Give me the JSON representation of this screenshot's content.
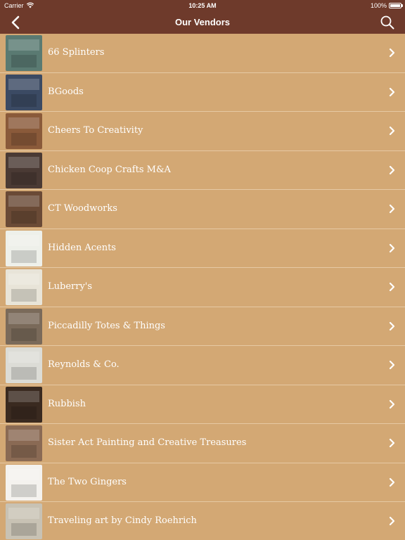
{
  "status_bar": {
    "carrier": "Carrier",
    "time": "10:25 AM",
    "battery": "100%"
  },
  "nav": {
    "title": "Our Vendors",
    "back_icon": "chevron-left-icon",
    "search_icon": "search-icon"
  },
  "vendors": [
    {
      "name": "66 Splinters",
      "thumb_color": "#5a7a72"
    },
    {
      "name": "BGoods",
      "thumb_color": "#3b4a63"
    },
    {
      "name": "Cheers To Creativity",
      "thumb_color": "#8a5a3a"
    },
    {
      "name": "Chicken Coop Crafts M&A",
      "thumb_color": "#4a3a34"
    },
    {
      "name": "CT Woodworks",
      "thumb_color": "#6a4a36"
    },
    {
      "name": "Hidden Acents",
      "thumb_color": "#eef0ea"
    },
    {
      "name": "Luberry's",
      "thumb_color": "#e8e4d8"
    },
    {
      "name": "Piccadilly Totes & Things",
      "thumb_color": "#7a6a5a"
    },
    {
      "name": "Reynolds & Co.",
      "thumb_color": "#dcdcd6"
    },
    {
      "name": "Rubbish",
      "thumb_color": "#3a2a20"
    },
    {
      "name": "Sister Act Painting and Creative Treasures",
      "thumb_color": "#8a6a54"
    },
    {
      "name": "The Two Gingers",
      "thumb_color": "#f4f2ee"
    },
    {
      "name": "Traveling art by Cindy Roehrich",
      "thumb_color": "#c8c2b4"
    }
  ],
  "colors": {
    "header": "#6e3a2b",
    "list_background": "#d3a874",
    "separator": "#e6c9a4",
    "text": "#ffffff"
  }
}
